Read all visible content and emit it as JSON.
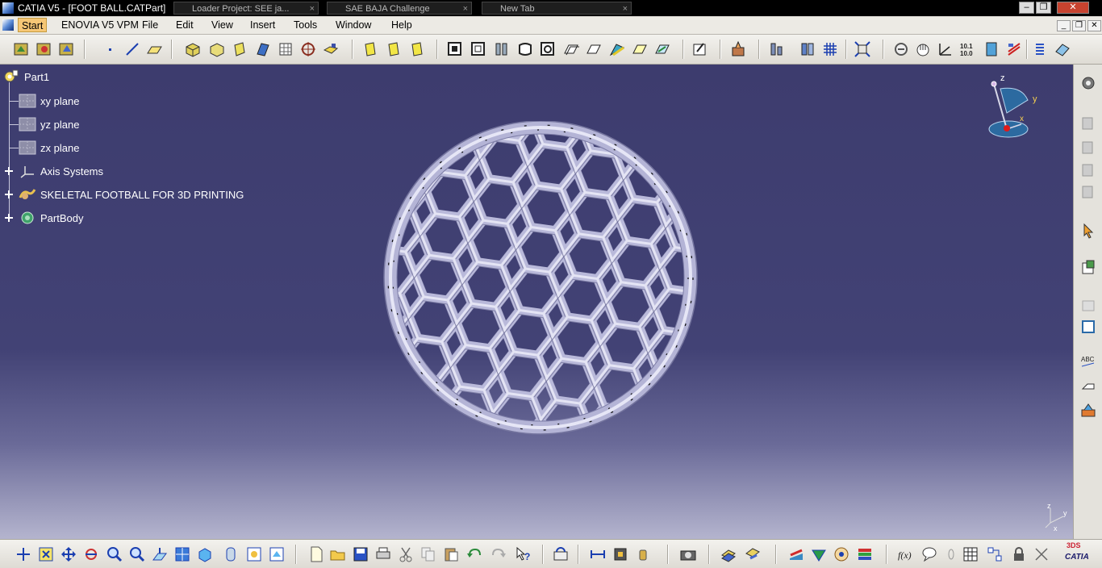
{
  "window": {
    "title": "CATIA V5 - [FOOT BALL.CATPart]",
    "taskbar_tabs": [
      {
        "label": "Loader Project: SEE ja...",
        "x": "215"
      },
      {
        "label": "SAE BAJA Challenge",
        "x": "405"
      },
      {
        "label": "New Tab",
        "x": "597"
      }
    ]
  },
  "menubar": {
    "start": "Start",
    "items": [
      "ENOVIA V5 VPM",
      "File",
      "Edit",
      "View",
      "Insert",
      "Tools",
      "Window",
      "Help"
    ]
  },
  "tree": {
    "root": "Part1",
    "planes": [
      "xy plane",
      "yz plane",
      "zx plane"
    ],
    "axis_systems": "Axis Systems",
    "geometric_set": "SKELETAL FOOTBALL FOR 3D PRINTING",
    "body": "PartBody"
  },
  "compass": {
    "z": "z",
    "y": "y",
    "x": "x"
  },
  "axis_mini": {
    "z": "z",
    "y": "y",
    "x": "x"
  },
  "logo": {
    "text": "CATIA",
    "mark": "3DS"
  },
  "icons": {
    "top_toolbar": [
      "sketcher-icon",
      "pad-icon",
      "pocket-icon",
      "point-icon",
      "line-icon",
      "plane-icon",
      "extrude-icon",
      "revolve-icon",
      "sweep-icon",
      "fill-icon",
      "multisection-icon",
      "sphere-icon",
      "join-icon",
      "split-icon",
      "trim-icon",
      "boundary-icon",
      "extract-icon",
      "thickness-icon",
      "fillet-icon",
      "chamfer-icon",
      "draft-icon",
      "shell-icon",
      "thick-icon",
      "thread-icon",
      "remove-face-icon",
      "replace-face-icon",
      "translate-icon",
      "rotate-icon",
      "symmetry-icon",
      "scale-icon",
      "affinity-icon",
      "measure-icon",
      "parameters-icon",
      "formula-icon",
      "catalog-icon",
      "snap-icon",
      "compass-icon",
      "grid-icon",
      "fit-all-icon",
      "pan-icon",
      "rotate-view-icon",
      "zoom-icon",
      "normal-view-icon",
      "iso-view-icon",
      "shading-icon",
      "hide-show-icon",
      "swap-icon"
    ],
    "right_toolbar": [
      "settings-icon",
      "layer-icon",
      "group-icon",
      "select-icon",
      "sketch-analysis-icon",
      "dimension-icon",
      "constraint-icon",
      "text-icon",
      "annotation-icon",
      "flag-icon"
    ],
    "bottom_toolbar": [
      "fly-icon",
      "fit-all-icon",
      "pan-icon",
      "rotate-icon",
      "zoom-in-icon",
      "zoom-out-icon",
      "normal-view-icon",
      "multi-view-icon",
      "iso-view-icon",
      "shading-icon",
      "hide-show-icon",
      "swap-visible-icon",
      "new-icon",
      "open-icon",
      "save-icon",
      "print-icon",
      "cut-icon",
      "copy-icon",
      "paste-icon",
      "undo-icon",
      "redo-icon",
      "whats-this-icon",
      "update-icon",
      "measure-between-icon",
      "measure-item-icon",
      "measure-inertia-icon",
      "capture-icon",
      "apply-material-icon",
      "render-icon",
      "publish-icon",
      "knowledge-icon",
      "macro-icon",
      "formula-icon",
      "comment-icon",
      "reactions-icon",
      "table-icon",
      "rules-icon",
      "lock-icon",
      "check-icon"
    ]
  },
  "colors": {
    "viewport_top": "#3d3c6e",
    "viewport_bottom": "#b4b4ce",
    "ball_fill": "#c3c3e1",
    "ball_edge": "#8a8ab3",
    "title_bar": "#000000",
    "start_highlight": "#f6c776"
  }
}
